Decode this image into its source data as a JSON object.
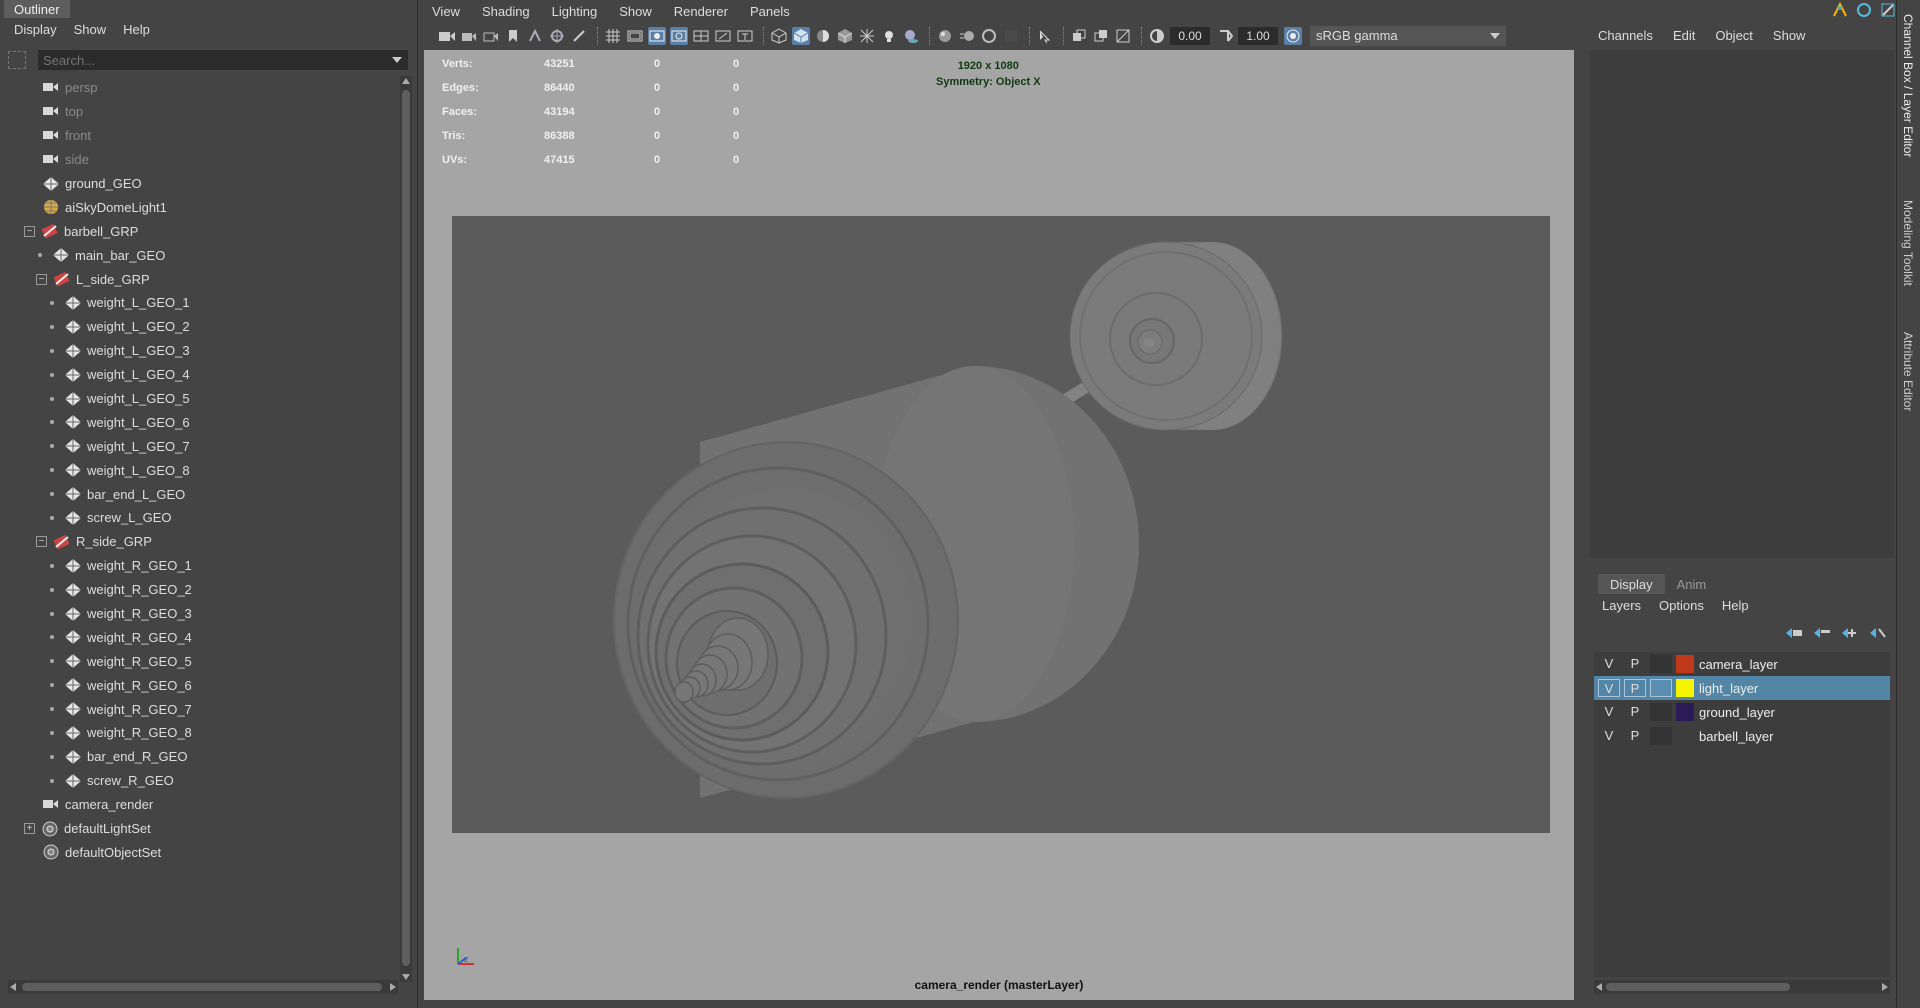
{
  "outliner": {
    "title": "Outliner",
    "menu": [
      "Display",
      "Show",
      "Help"
    ],
    "search_placeholder": "Search...",
    "items": [
      {
        "label": "persp",
        "icon": "camera-icon",
        "dim": true,
        "indent": 1
      },
      {
        "label": "top",
        "icon": "camera-icon",
        "dim": true,
        "indent": 1
      },
      {
        "label": "front",
        "icon": "camera-icon",
        "dim": true,
        "indent": 1
      },
      {
        "label": "side",
        "icon": "camera-icon",
        "dim": true,
        "indent": 1
      },
      {
        "label": "ground_GEO",
        "icon": "mesh-icon",
        "indent": 1
      },
      {
        "label": "aiSkyDomeLight1",
        "icon": "skydome-light-icon",
        "indent": 1
      },
      {
        "label": "barbell_GRP",
        "icon": "group-icon",
        "indent": 0,
        "expander": "−"
      },
      {
        "label": "main_bar_GEO",
        "icon": "mesh-icon",
        "indent": 2,
        "dot": true
      },
      {
        "label": "L_side_GRP",
        "icon": "group-icon",
        "indent": 1,
        "expander": "−"
      },
      {
        "label": "weight_L_GEO_1",
        "icon": "mesh-icon",
        "indent": 3,
        "dot": true
      },
      {
        "label": "weight_L_GEO_2",
        "icon": "mesh-icon",
        "indent": 3,
        "dot": true
      },
      {
        "label": "weight_L_GEO_3",
        "icon": "mesh-icon",
        "indent": 3,
        "dot": true
      },
      {
        "label": "weight_L_GEO_4",
        "icon": "mesh-icon",
        "indent": 3,
        "dot": true
      },
      {
        "label": "weight_L_GEO_5",
        "icon": "mesh-icon",
        "indent": 3,
        "dot": true
      },
      {
        "label": "weight_L_GEO_6",
        "icon": "mesh-icon",
        "indent": 3,
        "dot": true
      },
      {
        "label": "weight_L_GEO_7",
        "icon": "mesh-icon",
        "indent": 3,
        "dot": true
      },
      {
        "label": "weight_L_GEO_8",
        "icon": "mesh-icon",
        "indent": 3,
        "dot": true
      },
      {
        "label": "bar_end_L_GEO",
        "icon": "mesh-icon",
        "indent": 3,
        "dot": true
      },
      {
        "label": "screw_L_GEO",
        "icon": "mesh-icon",
        "indent": 3,
        "dot": true
      },
      {
        "label": "R_side_GRP",
        "icon": "group-icon",
        "indent": 1,
        "expander": "−"
      },
      {
        "label": "weight_R_GEO_1",
        "icon": "mesh-icon",
        "indent": 3,
        "dot": true
      },
      {
        "label": "weight_R_GEO_2",
        "icon": "mesh-icon",
        "indent": 3,
        "dot": true
      },
      {
        "label": "weight_R_GEO_3",
        "icon": "mesh-icon",
        "indent": 3,
        "dot": true
      },
      {
        "label": "weight_R_GEO_4",
        "icon": "mesh-icon",
        "indent": 3,
        "dot": true
      },
      {
        "label": "weight_R_GEO_5",
        "icon": "mesh-icon",
        "indent": 3,
        "dot": true
      },
      {
        "label": "weight_R_GEO_6",
        "icon": "mesh-icon",
        "indent": 3,
        "dot": true
      },
      {
        "label": "weight_R_GEO_7",
        "icon": "mesh-icon",
        "indent": 3,
        "dot": true
      },
      {
        "label": "weight_R_GEO_8",
        "icon": "mesh-icon",
        "indent": 3,
        "dot": true
      },
      {
        "label": "bar_end_R_GEO",
        "icon": "mesh-icon",
        "indent": 3,
        "dot": true
      },
      {
        "label": "screw_R_GEO",
        "icon": "mesh-icon",
        "indent": 3,
        "dot": true
      },
      {
        "label": "camera_render",
        "icon": "camera-icon",
        "indent": 1
      },
      {
        "label": "defaultLightSet",
        "icon": "set-icon",
        "indent": 0,
        "expander": "+"
      },
      {
        "label": "defaultObjectSet",
        "icon": "set-icon",
        "indent": 1
      }
    ]
  },
  "viewport": {
    "menu": [
      "View",
      "Shading",
      "Lighting",
      "Show",
      "Renderer",
      "Panels"
    ],
    "exposure": "0.00",
    "gamma": "1.00",
    "color_space": "sRGB gamma",
    "hud": [
      {
        "label": "Verts:",
        "v1": "43251",
        "v2": "0",
        "v3": "0"
      },
      {
        "label": "Edges:",
        "v1": "86440",
        "v2": "0",
        "v3": "0"
      },
      {
        "label": "Faces:",
        "v1": "43194",
        "v2": "0",
        "v3": "0"
      },
      {
        "label": "Tris:",
        "v1": "86388",
        "v2": "0",
        "v3": "0"
      },
      {
        "label": "UVs:",
        "v1": "47415",
        "v2": "0",
        "v3": "0"
      }
    ],
    "resolution": "1920 x 1080",
    "symmetry": "Symmetry: Object X",
    "camera_label": "camera_render (masterLayer)",
    "background_color": "#a5a5a5",
    "gate_color": "#5b5b5b"
  },
  "right_panel": {
    "menu": [
      "Channels",
      "Edit",
      "Object",
      "Show"
    ],
    "tabs": [
      "Display",
      "Anim"
    ],
    "layer_menu": [
      "Layers",
      "Options",
      "Help"
    ],
    "layers": [
      {
        "name": "camera_layer",
        "v": "V",
        "p": "P",
        "color": "#c0391b",
        "selected": false
      },
      {
        "name": "light_layer",
        "v": "V",
        "p": "P",
        "color": "#f5f500",
        "selected": true
      },
      {
        "name": "ground_layer",
        "v": "V",
        "p": "P",
        "color": "#2a1a55",
        "selected": false
      },
      {
        "name": "barbell_layer",
        "v": "V",
        "p": "P",
        "color": "#3d3d3d",
        "selected": false
      }
    ]
  },
  "side_tabs": [
    "Channel Box / Layer Editor",
    "Modeling Toolkit",
    "Attribute Editor"
  ]
}
